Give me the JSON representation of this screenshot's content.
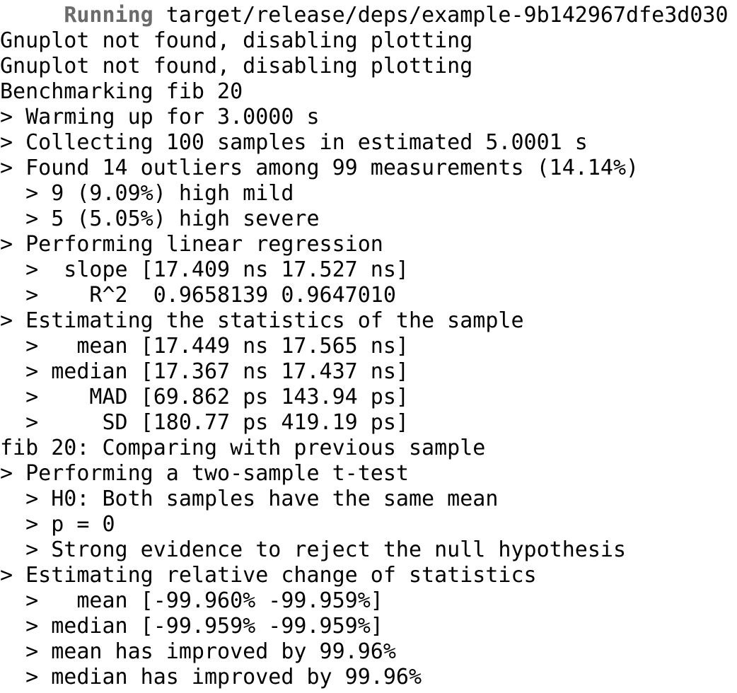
{
  "terminal": {
    "running_status": "Running",
    "running_prefix": "     ",
    "running_path": " target/release/deps/example-9b142967dfe3d030",
    "lines": [
      "Gnuplot not found, disabling plotting",
      "Gnuplot not found, disabling plotting",
      "Benchmarking fib 20",
      "> Warming up for 3.0000 s",
      "> Collecting 100 samples in estimated 5.0001 s",
      "> Found 14 outliers among 99 measurements (14.14%)",
      "  > 9 (9.09%) high mild",
      "  > 5 (5.05%) high severe",
      "> Performing linear regression",
      "  >  slope [17.409 ns 17.527 ns]",
      "  >    R^2  0.9658139 0.9647010",
      "> Estimating the statistics of the sample",
      "  >   mean [17.449 ns 17.565 ns]",
      "  > median [17.367 ns 17.437 ns]",
      "  >    MAD [69.862 ps 143.94 ps]",
      "  >     SD [180.77 ps 419.19 ps]",
      "fib 20: Comparing with previous sample",
      "> Performing a two-sample t-test",
      "  > H0: Both samples have the same mean",
      "  > p = 0",
      "  > Strong evidence to reject the null hypothesis",
      "> Estimating relative change of statistics",
      "  >   mean [-99.960% -99.959%]",
      "  > median [-99.959% -99.959%]",
      "  > mean has improved by 99.96%",
      "  > median has improved by 99.96%"
    ]
  }
}
